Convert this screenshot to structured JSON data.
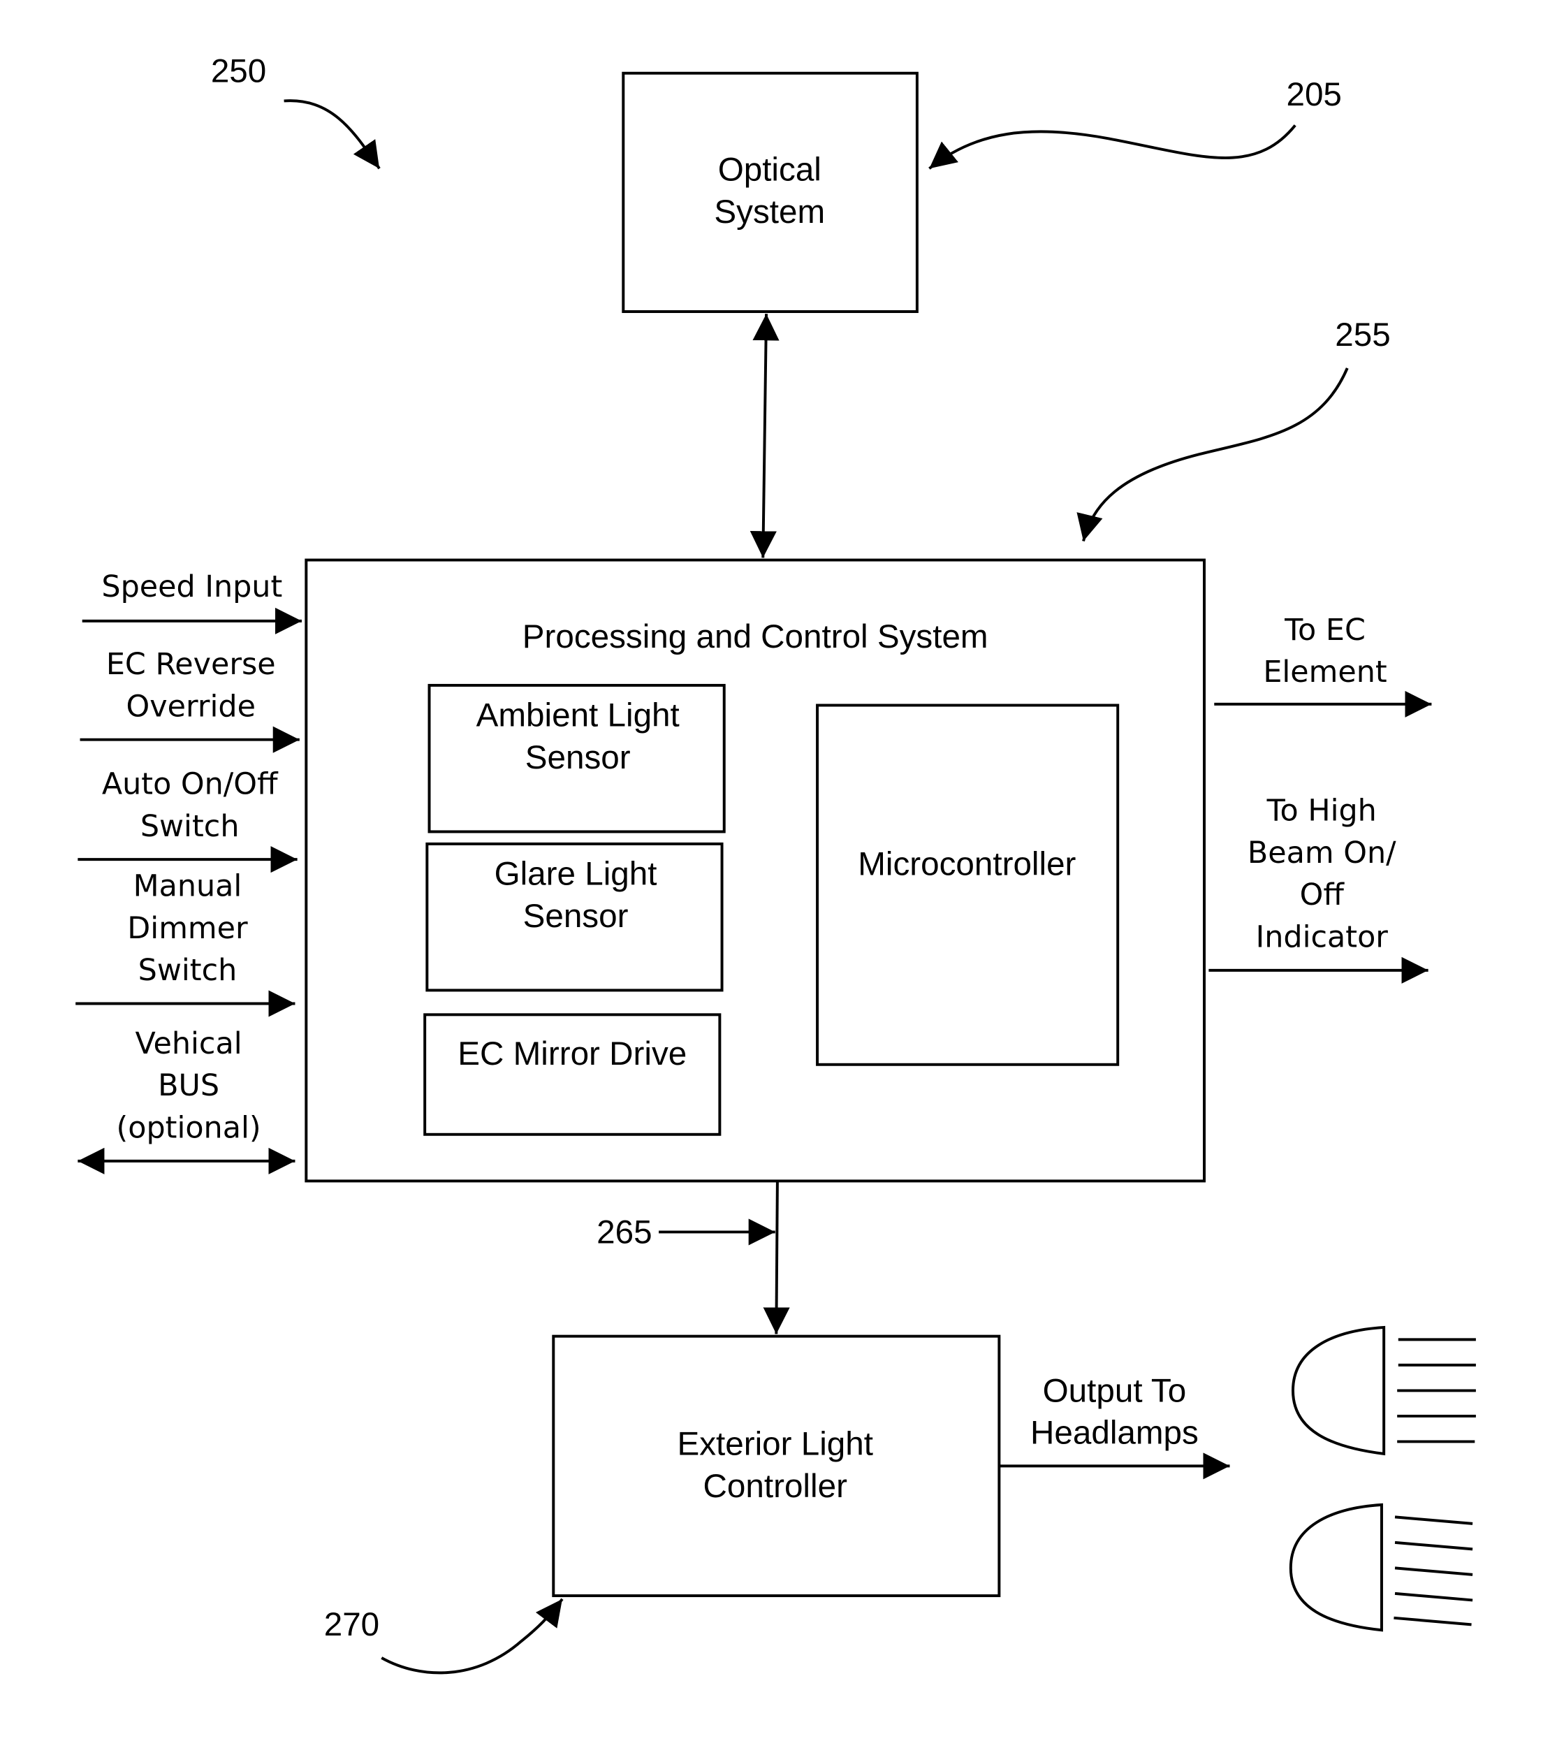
{
  "figure": {
    "reference_numerals": {
      "system": "250",
      "optical": "205",
      "processing": "255",
      "link": "265",
      "exterior": "270"
    },
    "optical_system": {
      "lines": [
        "Optical",
        "System"
      ]
    },
    "processing_system": {
      "title": "Processing and Control System",
      "ambient_sensor": [
        "Ambient Light",
        "Sensor"
      ],
      "glare_sensor": [
        "Glare Light",
        "Sensor"
      ],
      "ec_mirror_drive": "EC Mirror Drive",
      "microcontroller": "Microcontroller"
    },
    "inputs": {
      "speed": [
        "Speed Input"
      ],
      "ec_reverse": [
        "EC Reverse",
        "Override"
      ],
      "auto_switch": [
        "Auto On/Off",
        "Switch"
      ],
      "dimmer": [
        "Manual",
        "Dimmer",
        "Switch"
      ],
      "bus": [
        "Vehical",
        "BUS",
        "(optional)"
      ]
    },
    "outputs": {
      "ec_element": [
        "To EC",
        "Element"
      ],
      "high_beam": [
        "To High",
        "Beam On/",
        "Off",
        "Indicator"
      ],
      "headlamps": [
        "Output To",
        "Headlamps"
      ]
    },
    "exterior_light_controller": [
      "Exterior Light",
      "Controller"
    ],
    "icons": [
      "headlamp-high-beam-icon",
      "headlamp-low-beam-icon"
    ]
  }
}
